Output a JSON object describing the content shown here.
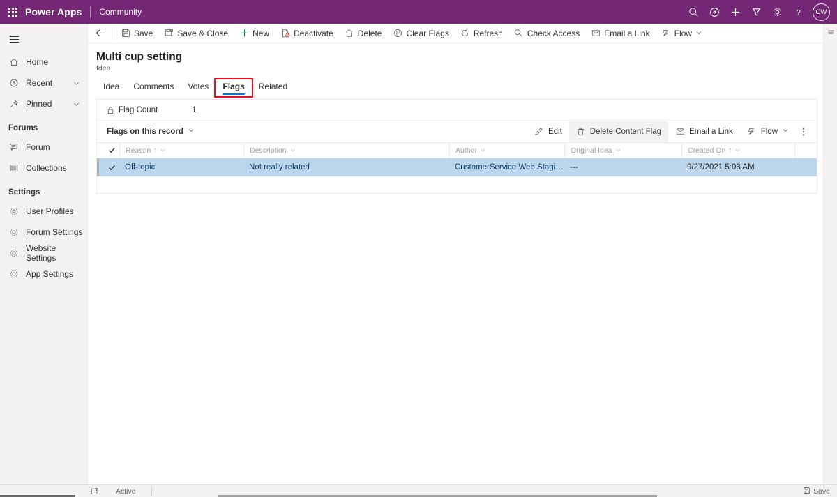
{
  "topbar": {
    "waffle_label": "app-launcher",
    "brand": "Power Apps",
    "environment": "Community",
    "icons": [
      {
        "name": "search-icon",
        "label": "Search"
      },
      {
        "name": "target-icon",
        "label": "Assistant"
      },
      {
        "name": "plus-icon",
        "label": "Quick create"
      },
      {
        "name": "filter-icon",
        "label": "Filter"
      },
      {
        "name": "gear-icon",
        "label": "Settings"
      },
      {
        "name": "help-icon",
        "label": "Help"
      }
    ],
    "avatar_initials": "CW"
  },
  "sidebar": {
    "hamburger_label": "Expand navigation",
    "items": [
      {
        "label": "Home",
        "icon": "home-icon",
        "chevron": false
      },
      {
        "label": "Recent",
        "icon": "clock-icon",
        "chevron": true
      },
      {
        "label": "Pinned",
        "icon": "pin-icon",
        "chevron": true
      }
    ],
    "groups": [
      {
        "title": "Forums",
        "items": [
          {
            "label": "Forum",
            "icon": "forum-icon"
          },
          {
            "label": "Collections",
            "icon": "collections-icon"
          }
        ]
      },
      {
        "title": "Settings",
        "items": [
          {
            "label": "User Profiles",
            "icon": "gear-icon"
          },
          {
            "label": "Forum Settings",
            "icon": "gear-icon"
          },
          {
            "label": "Website Settings",
            "icon": "gear-icon"
          },
          {
            "label": "App Settings",
            "icon": "gear-icon"
          }
        ]
      }
    ]
  },
  "commandbar": {
    "back_label": "Back",
    "buttons": [
      {
        "label": "Save",
        "icon": "save-icon"
      },
      {
        "label": "Save & Close",
        "icon": "save-close-icon"
      },
      {
        "label": "New",
        "icon": "plus-icon"
      },
      {
        "label": "Deactivate",
        "icon": "deactivate-icon"
      },
      {
        "label": "Delete",
        "icon": "trash-icon"
      },
      {
        "label": "Clear Flags",
        "icon": "clear-flags-icon"
      },
      {
        "label": "Refresh",
        "icon": "refresh-icon"
      },
      {
        "label": "Check Access",
        "icon": "key-icon"
      },
      {
        "label": "Email a Link",
        "icon": "email-link-icon"
      },
      {
        "label": "Flow",
        "icon": "flow-icon",
        "chevron": true
      }
    ]
  },
  "page": {
    "title": "Multi cup setting",
    "subtitle": "Idea",
    "tabs": [
      {
        "label": "Idea",
        "active": false,
        "highlighted": false
      },
      {
        "label": "Comments",
        "active": false,
        "highlighted": false
      },
      {
        "label": "Votes",
        "active": false,
        "highlighted": false
      },
      {
        "label": "Flags",
        "active": true,
        "highlighted": true
      },
      {
        "label": "Related",
        "active": false,
        "highlighted": false
      }
    ],
    "highlight_color": "#e81123",
    "accent_color": "#0078d4"
  },
  "flag_count": {
    "label": "Flag Count",
    "value": "1",
    "locked": true
  },
  "subgrid": {
    "view_name": "Flags on this record",
    "actions": [
      {
        "label": "Edit",
        "icon": "pencil-icon",
        "hovered": false
      },
      {
        "label": "Delete Content Flag",
        "icon": "trash-icon",
        "hovered": true
      },
      {
        "label": "Email a Link",
        "icon": "email-link-icon",
        "hovered": false
      },
      {
        "label": "Flow",
        "icon": "flow-icon",
        "chevron": true,
        "hovered": false
      }
    ],
    "more_label": "More commands",
    "columns": [
      {
        "label": "Reason",
        "sorted": "asc",
        "class": "col-reason"
      },
      {
        "label": "Description",
        "sorted": "",
        "class": "col-desc"
      },
      {
        "label": "Author",
        "sorted": "",
        "class": "col-author"
      },
      {
        "label": "Original Idea",
        "sorted": "",
        "class": "col-orig"
      },
      {
        "label": "Created On",
        "sorted": "asc",
        "class": "col-created"
      }
    ],
    "rows": [
      {
        "selected": true,
        "reason": "Off-topic",
        "description": "Not really related",
        "author": "CustomerService Web Staging",
        "original_idea": "---",
        "created_on": "9/27/2021 5:03 AM"
      }
    ],
    "selected_row_color": "#bcd6ec"
  },
  "rail": {
    "icon": "timeline-icon"
  },
  "statusbar": {
    "expand_label": "Open in new window",
    "status": "Active",
    "save_label": "Save",
    "save_icon": "save-icon"
  }
}
